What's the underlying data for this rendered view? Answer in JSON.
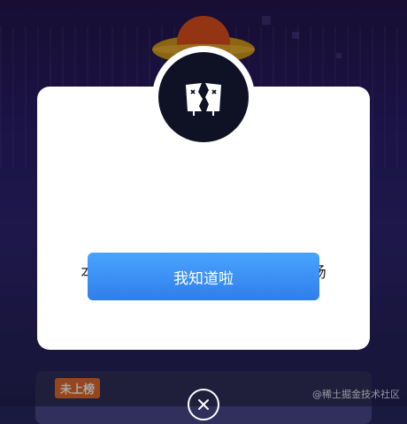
{
  "dialog": {
    "message": "本场BugFix已结束，敬请期待下一场",
    "confirm_label": "我知道啦",
    "icon": "broken-card-icon",
    "close_icon": "close-icon"
  },
  "background": {
    "rank_tag": "未上榜"
  },
  "watermark": "@稀土掘金技术社区",
  "colors": {
    "accent": "#2f7fe9",
    "modal": "#ffffff",
    "badge": "#0f1125",
    "rank_tag": "#e96c2a"
  }
}
